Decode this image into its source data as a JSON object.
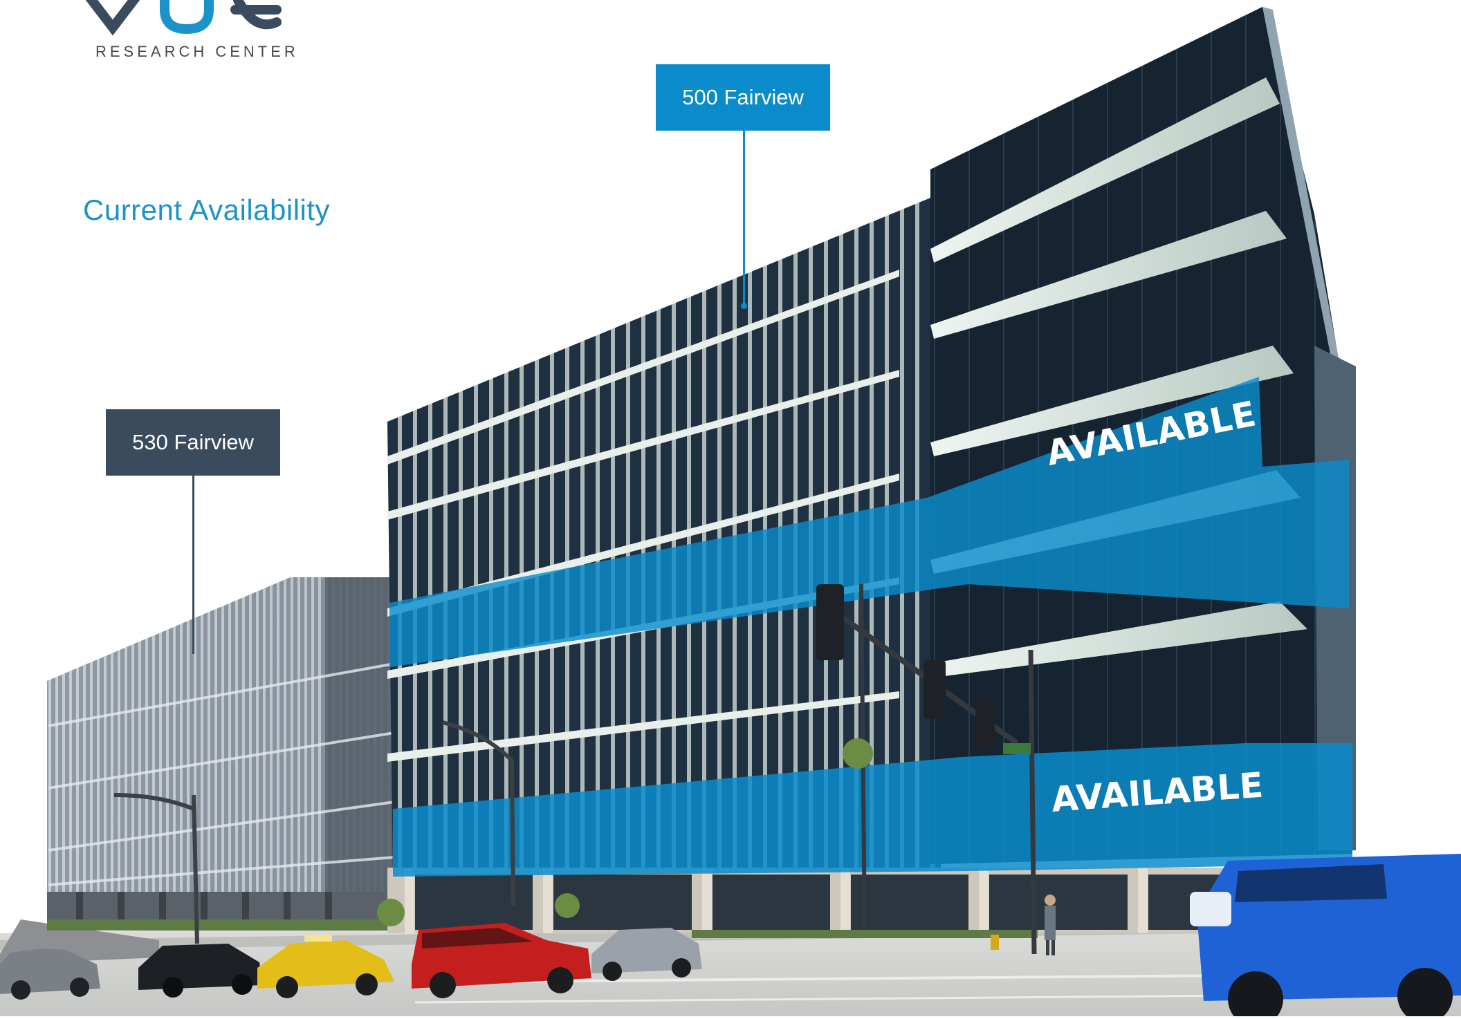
{
  "logo": {
    "mark_color": "#3b4b5e",
    "accent_color": "#1c93c8",
    "subtitle": "RESEARCH CENTER"
  },
  "headline": "Current Availability",
  "callouts": {
    "building_500": {
      "label": "500 Fairview",
      "color": "#0a8ccc"
    },
    "building_530": {
      "label": "530 Fairview",
      "color": "#3b4b5e"
    }
  },
  "availability": {
    "upper_label": "AVAILABLE",
    "lower_label": "AVAILABLE",
    "overlay_color": "#0a8ccc"
  },
  "colors": {
    "sky": "#ffffff",
    "glass_dark": "#1c2a38",
    "fin_light": "#d8e6e0",
    "concrete": "#cfc7bc",
    "street": "#d6d7d5"
  }
}
